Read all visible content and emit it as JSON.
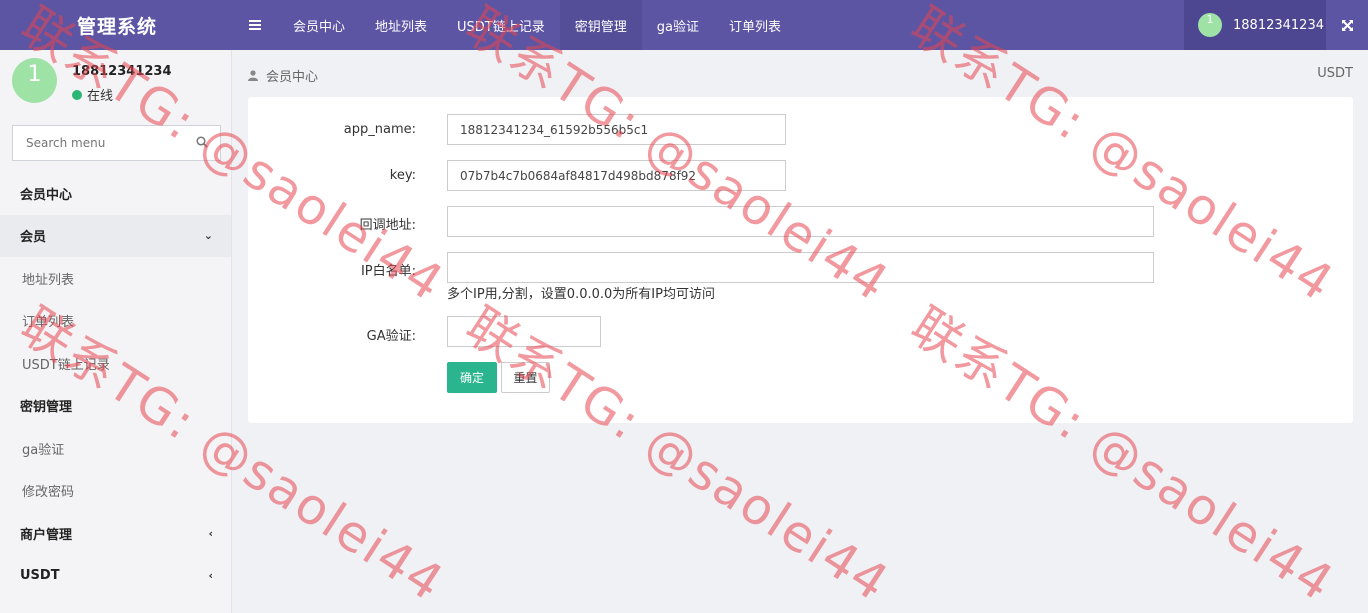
{
  "app": {
    "title": "管理系统"
  },
  "topnav": {
    "menu_icon": "hamburger-icon",
    "tabs": [
      {
        "label": "会员中心",
        "active": false
      },
      {
        "label": "地址列表",
        "active": false
      },
      {
        "label": "USDT链上记录",
        "active": false
      },
      {
        "label": "密钥管理",
        "active": true
      },
      {
        "label": "ga验证",
        "active": false
      },
      {
        "label": "订单列表",
        "active": false
      }
    ],
    "user": {
      "avatar_text": "1",
      "phone": "18812341234"
    },
    "fullscreen_icon": "expand-icon"
  },
  "sidebar": {
    "user": {
      "avatar_text": "1",
      "name": "18812341234",
      "status": "在线"
    },
    "search": {
      "placeholder": "Search menu",
      "icon": "search-icon"
    },
    "menu": [
      {
        "label": "会员中心",
        "type": "head"
      },
      {
        "label": "会员",
        "type": "head",
        "chevron": "down"
      },
      {
        "label": "地址列表",
        "type": "sub"
      },
      {
        "label": "订单列表",
        "type": "sub"
      },
      {
        "label": "USDT链上记录",
        "type": "sub"
      },
      {
        "label": "密钥管理",
        "type": "head"
      },
      {
        "label": "ga验证",
        "type": "sub"
      },
      {
        "label": "修改密码",
        "type": "sub"
      },
      {
        "label": "商户管理",
        "type": "head",
        "chevron": "left"
      },
      {
        "label": "USDT",
        "type": "head",
        "chevron": "left"
      }
    ]
  },
  "breadcrumb": {
    "label": "会员中心",
    "icon": "person-icon",
    "right": "USDT"
  },
  "form": {
    "app_name": {
      "label": "app_name:",
      "value": "18812341234_61592b556b5c1"
    },
    "key": {
      "label": "key:",
      "value": "07b7b4c7b0684af84817d498bd878f92"
    },
    "callback": {
      "label": "回调地址:",
      "value": ""
    },
    "ip_whitelist": {
      "label": "IP白名单:",
      "value": "",
      "help": "多个IP用,分割，设置0.0.0.0为所有IP均可访问"
    },
    "ga": {
      "label": "GA验证:",
      "value": ""
    },
    "submit_label": "确定",
    "reset_label": "重置"
  },
  "watermark": {
    "text": "联系TG: @saolei44",
    "color": "#e84650"
  }
}
